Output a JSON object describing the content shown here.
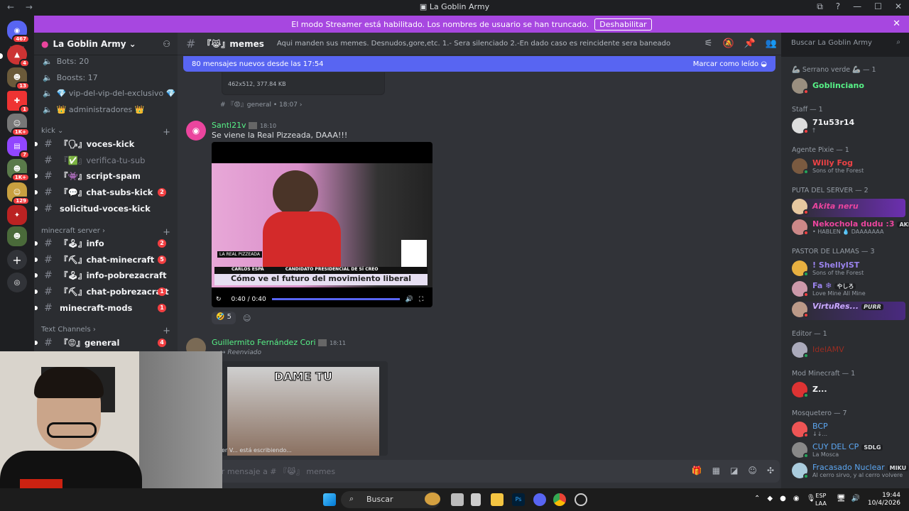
{
  "window": {
    "title": "La Goblin Army",
    "nav": "← →",
    "controls": [
      "⧉",
      "?",
      "—",
      "☐",
      "✕"
    ]
  },
  "banner": {
    "text": "El modo Streamer está habilitado. Los nombres de usuario se han truncado.",
    "button": "Deshabilitar"
  },
  "rail": {
    "badges": [
      "467",
      "4",
      "13",
      "1",
      "1K+",
      "7",
      "1K+",
      "129"
    ]
  },
  "sidebar": {
    "server_name": "La Goblin Army",
    "stats": [
      "Bots: 20",
      "Boosts: 17",
      "💎 vip-del-vip-del-exclusivo 💎",
      "👑 administradores 👑"
    ],
    "categories": [
      "kick",
      "minecraft server",
      "Text Channels"
    ],
    "kick_channels": [
      {
        "name": "『🗣』voces-kick",
        "badge": ""
      },
      {
        "name": "『✅』verifica-tu-sub",
        "badge": ""
      },
      {
        "name": "『👾』script-spam",
        "badge": ""
      },
      {
        "name": "『💬』chat-subs-kick",
        "badge": "2"
      },
      {
        "name": "solicitud-voces-kick",
        "badge": ""
      }
    ],
    "mc_channels": [
      {
        "name": "『🕹』info",
        "badge": "2"
      },
      {
        "name": "『⛏』chat-minecraft",
        "badge": "5"
      },
      {
        "name": "『🕹』info-pobrezacraft",
        "badge": ""
      },
      {
        "name": "『⛏』chat-pobrezacraft",
        "badge": "1"
      },
      {
        "name": "minecraft-mods",
        "badge": "1"
      }
    ],
    "text_channels": [
      {
        "name": "『😡』general",
        "badge": "4"
      }
    ]
  },
  "channel": {
    "name": "『😹』memes",
    "topic": "Aqui manden sus memes. Desnudos,gore,etc. 1.- Sera silenciado 2.-En dado caso es reincidente sera baneado",
    "new_messages": "80 mensajes nuevos desde las 17:54",
    "mark_read": "Marcar como leído",
    "search_placeholder": "Buscar La Goblin Army"
  },
  "messages": {
    "file_meta": "462x512, 377.84 KB",
    "fwd_channel": "『😡』general",
    "fwd_time": "18:07",
    "m1": {
      "user": "Santi21v",
      "time": "18:10",
      "text": "Se viene la Real Pizzeada, DAAA!!!",
      "video_time": "0:40 / 0:40",
      "video_caption": "Cómo ve el futuro del movimiento liberal",
      "video_lower_name": "CARLOS ESPÁ",
      "video_lower_title": "CANDIDATO PRESIDENCIAL DE SÍ CREO",
      "video_tag": "LA REAL PIZZEADA",
      "reaction_count": "5"
    },
    "m2": {
      "user": "Guillermito Fernández Cori",
      "time": "18:11",
      "forwarded": "Reenviado",
      "meme_text": "DAME TU"
    },
    "typing": "er V... está escribiendo...",
    "compose_placeholder": "iar mensaje a # 『😹』 memes"
  },
  "members": {
    "groups": [
      {
        "role": "🦾 Serrano verde 🦾 — 1",
        "items": [
          {
            "name": "Goblinciano",
            "sub": "",
            "color": "#57f287"
          }
        ]
      },
      {
        "role": "Staff — 1",
        "items": [
          {
            "name": "71u53r14",
            "sub": "†",
            "color": "#f2f3f5"
          }
        ]
      },
      {
        "role": "Agente Pixie — 1",
        "items": [
          {
            "name": "Willy Fog",
            "sub": "Sons of the Forest",
            "color": "#ed4245"
          }
        ]
      },
      {
        "role": "PUTA DEL SERVER — 2",
        "items": [
          {
            "name": "Akita neru",
            "sub": "",
            "color": "#eb459e"
          },
          {
            "name": "Nekochola dudu :3",
            "sub": "• HABLEN 💧 DAAAAAAA",
            "color": "#eb459e",
            "tag": "AKEF"
          }
        ]
      },
      {
        "role": "PASTOR DE LLAMAS — 3",
        "items": [
          {
            "name": "! ShellyIST",
            "sub": "Sons of the Forest",
            "color": "#9b84ee"
          },
          {
            "name": "Fa ❄",
            "sub": "Love Mine All Mine",
            "color": "#9b84ee",
            "tag": "やしろ"
          },
          {
            "name": "VirtuRes...",
            "sub": "",
            "color": "#9b84ee",
            "tag": "PURR"
          }
        ]
      },
      {
        "role": "Editor — 1",
        "items": [
          {
            "name": "IdelAMV",
            "sub": "",
            "color": "#992d22"
          }
        ]
      },
      {
        "role": "Mod Minecraft — 1",
        "items": [
          {
            "name": "Z...",
            "sub": "",
            "color": "#f2f3f5"
          }
        ]
      },
      {
        "role": "Mosquetero — 7",
        "items": [
          {
            "name": "BCP",
            "sub": "↓↓...",
            "color": "#5ca7f2"
          },
          {
            "name": "CUY DEL CP",
            "sub": "La Mosca",
            "color": "#5ca7f2",
            "tag": "SDLG"
          },
          {
            "name": "Fracasado Nuclear",
            "sub": "Al cerro sirvo, y al cerro volvere",
            "color": "#5ca7f2",
            "tag": "MIKU"
          }
        ]
      }
    ]
  },
  "taskbar": {
    "search": "Buscar",
    "lang1": "ESP",
    "lang2": "LAA",
    "time": "19:44",
    "date": "10/4/2026"
  }
}
